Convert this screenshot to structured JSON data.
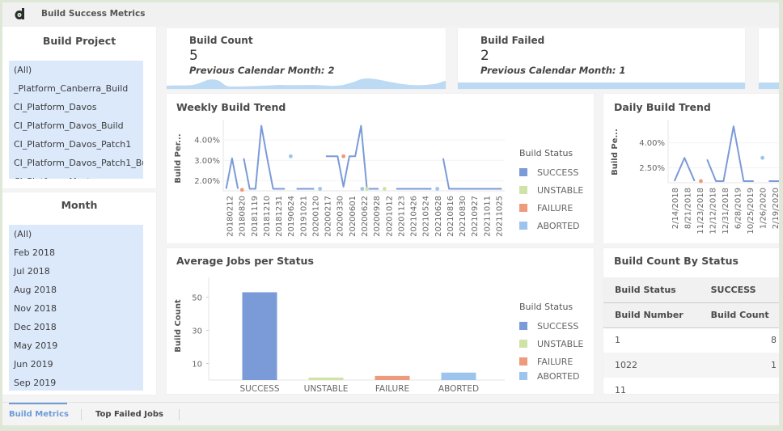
{
  "app": {
    "title": "Build Success Metrics",
    "logo_icon": "d-logo-icon"
  },
  "filters": {
    "build_project": {
      "title": "Build Project",
      "items": [
        "(All)",
        "_Platform_Canberra_Build",
        "CI_Platform_Davos",
        "CI_Platform_Davos_Build",
        "CI_Platform_Davos_Patch1",
        "CI_Platform_Davos_Patch1_Bu",
        "CI_Platform_Master"
      ]
    },
    "month": {
      "title": "Month",
      "items": [
        "(All)",
        "Feb 2018",
        "Jul 2018",
        "Aug 2018",
        "Nov 2018",
        "Dec 2018",
        "May 2019",
        "Jun 2019",
        "Sep 2019"
      ]
    }
  },
  "kpis": [
    {
      "label": "Build Count",
      "value": "5",
      "previous": "Previous Calendar Month: 2"
    },
    {
      "label": "Build Failed",
      "value": "2",
      "previous": "Previous Calendar Month: 1"
    }
  ],
  "legend": {
    "title": "Build Status",
    "items": [
      {
        "label": "SUCCESS",
        "color": "#7b9bd8"
      },
      {
        "label": "UNSTABLE",
        "color": "#cfe3a6"
      },
      {
        "label": "FAILURE",
        "color": "#ee9a7c"
      },
      {
        "label": "ABORTED",
        "color": "#9cc4ec"
      }
    ]
  },
  "chart_data": [
    {
      "type": "line",
      "title": "Weekly Build Trend",
      "xlabel": "",
      "ylabel": "Build Per...",
      "yticks": [
        "2.00%",
        "3.00%",
        "4.00%"
      ],
      "ylim": [
        1.5,
        5.0
      ],
      "grid": true,
      "legend": "right",
      "categories": [
        "20180212",
        "20180820",
        "20181119",
        "20181210",
        "20181231",
        "20190624",
        "20191021",
        "20200120",
        "20200217",
        "20200330",
        "20200601",
        "20200622",
        "20200928",
        "20201012",
        "20201123",
        "20210426",
        "20210524",
        "20210628",
        "20210816",
        "20210830",
        "20210927",
        "20211011",
        "20211025"
      ],
      "series": [
        {
          "name": "SUCCESS",
          "points": [
            [
              0,
              1.6
            ],
            [
              1,
              3.1
            ],
            [
              2,
              1.6
            ],
            [
              null,
              null
            ],
            [
              3,
              3.1
            ],
            [
              4,
              1.6
            ],
            [
              5,
              1.6
            ],
            [
              6,
              4.7
            ],
            [
              7,
              3.1
            ],
            [
              8,
              1.6
            ],
            [
              9,
              1.6
            ],
            [
              10,
              1.6
            ],
            [
              null,
              null
            ],
            [
              12,
              1.6
            ],
            [
              13,
              1.6
            ],
            [
              14,
              1.6
            ],
            [
              15,
              1.6
            ],
            [
              null,
              null
            ],
            [
              17,
              3.2
            ],
            [
              18,
              3.2
            ],
            [
              19,
              3.2
            ],
            [
              20,
              1.7
            ],
            [
              21,
              3.2
            ],
            [
              22,
              3.2
            ],
            [
              23,
              4.7
            ],
            [
              24,
              1.6
            ],
            [
              25,
              1.6
            ],
            [
              26,
              1.6
            ],
            [
              null,
              null
            ],
            [
              29,
              1.6
            ],
            [
              30,
              1.6
            ],
            [
              31,
              1.6
            ],
            [
              32,
              1.6
            ],
            [
              33,
              1.6
            ],
            [
              34,
              1.6
            ],
            [
              35,
              1.6
            ],
            [
              null,
              null
            ],
            [
              37,
              3.1
            ],
            [
              38,
              1.6
            ],
            [
              39,
              1.6
            ],
            [
              40,
              1.6
            ],
            [
              41,
              1.6
            ],
            [
              42,
              1.6
            ],
            [
              43,
              1.6
            ],
            [
              44,
              1.6
            ],
            [
              45,
              1.6
            ],
            [
              46,
              1.6
            ],
            [
              47,
              1.6
            ]
          ]
        },
        {
          "name": "UNSTABLE",
          "points": [
            [
              24,
              1.6
            ],
            [
              27,
              1.6
            ]
          ]
        },
        {
          "name": "FAILURE",
          "points": [
            [
              2.7,
              1.55
            ],
            [
              20,
              3.2
            ]
          ]
        },
        {
          "name": "ABORTED",
          "points": [
            [
              11,
              3.2
            ],
            [
              16,
              1.6
            ],
            [
              23.2,
              1.6
            ],
            [
              36,
              1.6
            ]
          ]
        }
      ]
    },
    {
      "type": "line",
      "title": "Daily Build Trend",
      "ylabel": "Build Pe...",
      "yticks": [
        "2.50%",
        "4.00%"
      ],
      "ylim": [
        1.6,
        5.4
      ],
      "categories": [
        "2/14/2018",
        "8/21/2018",
        "11/23/2018",
        "12/12/2018",
        "12/31/2018",
        "6/28/2019",
        "10/25/2019",
        "1/26/2020",
        "2/19/2020"
      ],
      "series": [
        {
          "name": "SUCCESS",
          "points": [
            [
              0,
              1.7
            ],
            [
              0.8,
              3.1
            ],
            [
              1.6,
              1.7
            ],
            [
              null,
              null
            ],
            [
              2.6,
              3.0
            ],
            [
              3.3,
              1.7
            ],
            [
              3.9,
              1.7
            ],
            [
              4.7,
              5.0
            ],
            [
              5.5,
              1.7
            ],
            [
              6.3,
              1.7
            ],
            [
              null,
              null
            ],
            [
              7.5,
              1.7
            ],
            [
              8.6,
              1.7
            ]
          ]
        },
        {
          "name": "FAILURE",
          "points": [
            [
              2.1,
              1.7
            ]
          ]
        },
        {
          "name": "ABORTED",
          "points": [
            [
              7.0,
              3.1
            ]
          ]
        }
      ]
    },
    {
      "type": "bar",
      "title": "Average Jobs per Status",
      "xlabel": "",
      "ylabel": "Build Count",
      "yticks": [
        10,
        30,
        50
      ],
      "ylim": [
        0,
        62
      ],
      "categories": [
        "SUCCESS",
        "UNSTABLE",
        "FAILURE",
        "ABORTED"
      ],
      "values": [
        53,
        1.5,
        2.5,
        4.5
      ],
      "legend": "right"
    },
    {
      "type": "table",
      "title": "Build Count By Status",
      "header_row_1": [
        "Build Status",
        "SUCCESS"
      ],
      "header_row_2": [
        "Build Number",
        "Build Count"
      ],
      "rows": [
        [
          "1",
          "8"
        ],
        [
          "1022",
          "1"
        ],
        [
          "11",
          ""
        ]
      ]
    }
  ],
  "tabs": [
    {
      "label": "Build Metrics",
      "active": true
    },
    {
      "label": "Top Failed Jobs",
      "active": false
    }
  ]
}
